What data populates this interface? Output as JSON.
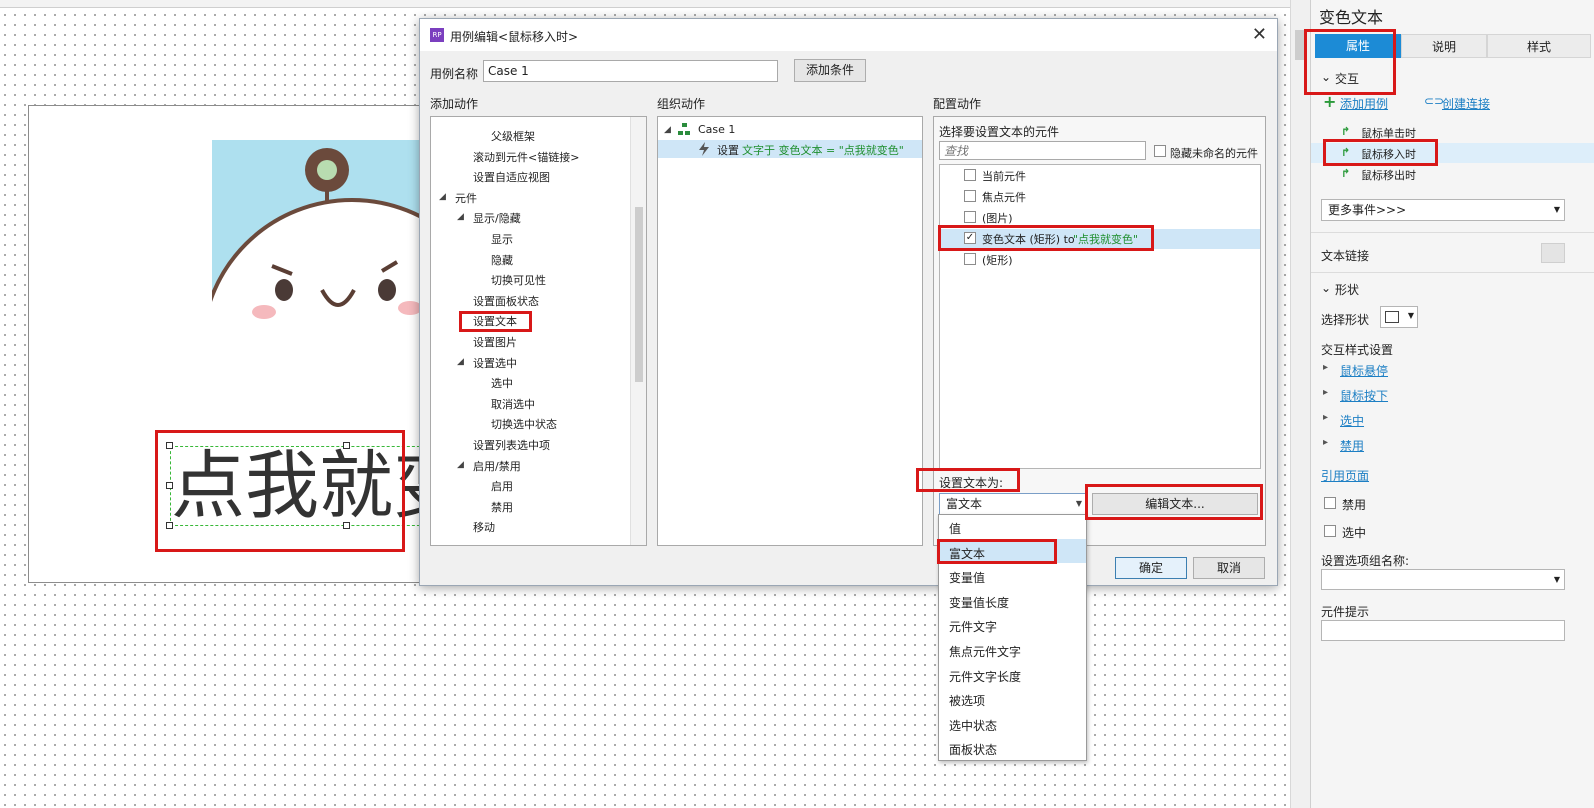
{
  "dialog": {
    "title": "用例编辑<鼠标移入时>",
    "close_glyph": "✕",
    "case_name_label": "用例名称",
    "case_name_value": "Case 1",
    "add_condition_label": "添加条件",
    "add_action_header": "添加动作",
    "organize_action_header": "组织动作",
    "configure_action_header": "配置动作",
    "ok_label": "确定",
    "cancel_label": "取消"
  },
  "add_actions": {
    "items": [
      {
        "label": "父级框架",
        "level": 3
      },
      {
        "label": "滚动到元件<锚链接>",
        "level": 2
      },
      {
        "label": "设置自适应视图",
        "level": 2
      },
      {
        "label": "元件",
        "level": 1,
        "expand": "◢"
      },
      {
        "label": "显示/隐藏",
        "level": 2,
        "expand": "◢"
      },
      {
        "label": "显示",
        "level": 3
      },
      {
        "label": "隐藏",
        "level": 3
      },
      {
        "label": "切换可见性",
        "level": 3
      },
      {
        "label": "设置面板状态",
        "level": 2
      },
      {
        "label": "设置文本",
        "level": 2
      },
      {
        "label": "设置图片",
        "level": 2
      },
      {
        "label": "设置选中",
        "level": 2,
        "expand": "◢"
      },
      {
        "label": "选中",
        "level": 3
      },
      {
        "label": "取消选中",
        "level": 3
      },
      {
        "label": "切换选中状态",
        "level": 3
      },
      {
        "label": "设置列表选中项",
        "level": 2
      },
      {
        "label": "启用/禁用",
        "level": 2,
        "expand": "◢"
      },
      {
        "label": "启用",
        "level": 3
      },
      {
        "label": "禁用",
        "level": 3
      },
      {
        "label": "移动",
        "level": 2
      }
    ]
  },
  "organize": {
    "case_label": "Case 1",
    "action_prefix": "设置",
    "action_detail": "文字于 变色文本 = \"点我就变色\""
  },
  "configure": {
    "select_widgets_label": "选择要设置文本的元件",
    "search_placeholder": "查找",
    "hide_unnamed_label": "隐藏未命名的元件",
    "widgets": [
      {
        "label": "当前元件",
        "checked": false
      },
      {
        "label": "焦点元件",
        "checked": false
      },
      {
        "label": "(图片)",
        "checked": false
      },
      {
        "label": "变色文本 (矩形) to",
        "value": "\"点我就变色\"",
        "checked": true
      },
      {
        "label": "(矩形)",
        "checked": false
      }
    ],
    "check_glyph": "✓",
    "set_text_to_label": "设置文本为:",
    "set_text_selected": "富文本",
    "edit_text_label": "编辑文本..."
  },
  "dropdown_options": [
    "值",
    "富文本",
    "变量值",
    "变量值长度",
    "元件文字",
    "焦点元件文字",
    "元件文字长度",
    "被选项",
    "选中状态",
    "面板状态"
  ],
  "canvas": {
    "widget_text": "点我就变色"
  },
  "right_panel": {
    "widget_name": "变色文本",
    "tabs": [
      "属性",
      "说明",
      "样式"
    ],
    "interaction_header": "交互",
    "add_case_label": "添加用例",
    "create_link_label": "创建连接",
    "events": [
      "鼠标单击时",
      "鼠标移入时",
      "鼠标移出时"
    ],
    "more_events_label": "更多事件>>>",
    "text_link_label": "文本链接",
    "shape_header": "形状",
    "select_shape_label": "选择形状",
    "interaction_style_label": "交互样式设置",
    "style_links": [
      "鼠标悬停",
      "鼠标按下",
      "选中",
      "禁用"
    ],
    "ref_page_label": "引用页面",
    "disabled_label": "禁用",
    "selected_label": "选中",
    "option_group_label": "设置选项组名称:",
    "tooltip_label": "元件提示"
  },
  "colors": {
    "accent": "#1c8bd6",
    "highlight": "#d81818",
    "green_text": "#1f8f2f",
    "selection_bg": "#cfe6f7"
  }
}
